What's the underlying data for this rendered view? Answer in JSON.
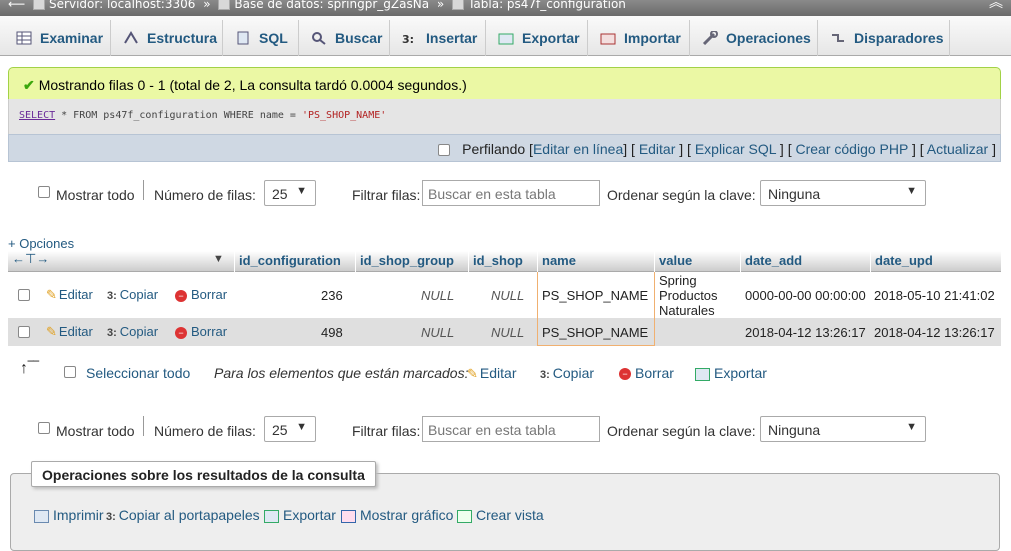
{
  "breadcrumb": {
    "server": "Servidor: localhost:3306",
    "database": "Base de datos: springpr_gZasNa",
    "table": "Tabla: ps47f_configuration",
    "separator": "»"
  },
  "tabs": [
    {
      "label": "Examinar",
      "icon": "browse-icon"
    },
    {
      "label": "Estructura",
      "icon": "structure-icon"
    },
    {
      "label": "SQL",
      "icon": "sql-icon"
    },
    {
      "label": "Buscar",
      "icon": "search-icon"
    },
    {
      "label": "Insertar",
      "icon": "insert-icon"
    },
    {
      "label": "Exportar",
      "icon": "export-icon"
    },
    {
      "label": "Importar",
      "icon": "import-icon"
    },
    {
      "label": "Operaciones",
      "icon": "wrench-icon"
    },
    {
      "label": "Disparadores",
      "icon": "triggers-icon"
    }
  ],
  "message": {
    "success_text": "Mostrando filas 0 - 1 (total de 2, La consulta tardó 0.0004 segundos.)",
    "sql_select": "SELECT",
    "sql_rest": " * FROM ps47f_configuration WHERE name = ",
    "sql_string": "'PS_SHOP_NAME'"
  },
  "profiling": {
    "label": "Perfilando",
    "links": [
      "Editar en línea",
      "Editar",
      "Explicar SQL",
      "Crear código PHP",
      "Actualizar"
    ]
  },
  "nav": {
    "show_all": "Mostrar todo",
    "rows_label": "Número de filas:",
    "rows_value": "25",
    "filter_label": "Filtrar filas:",
    "filter_placeholder": "Buscar en esta tabla",
    "sort_label": "Ordenar según la clave:",
    "sort_value": "Ninguna"
  },
  "options_link": "+ Opciones",
  "table": {
    "columns": [
      "id_configuration",
      "id_shop_group",
      "id_shop",
      "name",
      "value",
      "date_add",
      "date_upd"
    ],
    "row_actions": {
      "edit": "Editar",
      "copy": "Copiar",
      "delete": "Borrar"
    },
    "rows": [
      {
        "id_configuration": "236",
        "id_shop_group": "NULL",
        "id_shop": "NULL",
        "name": "PS_SHOP_NAME",
        "value": [
          "Spring",
          "Productos",
          "Naturales"
        ],
        "date_add": "0000-00-00 00:00:00",
        "date_upd": "2018-05-10 21:41:02"
      },
      {
        "id_configuration": "498",
        "id_shop_group": "NULL",
        "id_shop": "NULL",
        "name": "PS_SHOP_NAME",
        "value": [
          "",
          "",
          ""
        ],
        "date_add": "2018-04-12 13:26:17",
        "date_upd": "2018-04-12 13:26:17"
      }
    ]
  },
  "bulk": {
    "select_all": "Seleccionar todo",
    "marked_label": "Para los elementos que están marcados:",
    "edit": "Editar",
    "copy": "Copiar",
    "delete": "Borrar",
    "export": "Exportar"
  },
  "query_ops": {
    "legend": "Operaciones sobre los resultados de la consulta",
    "print": "Imprimir",
    "copy_clipboard": "Copiar al portapapeles",
    "export": "Exportar",
    "chart": "Mostrar gráfico",
    "create_view": "Crear vista"
  },
  "colors": {
    "link": "#235a81",
    "success_bg": "#ebf8a4",
    "row_alt": "#dfdfdf"
  }
}
